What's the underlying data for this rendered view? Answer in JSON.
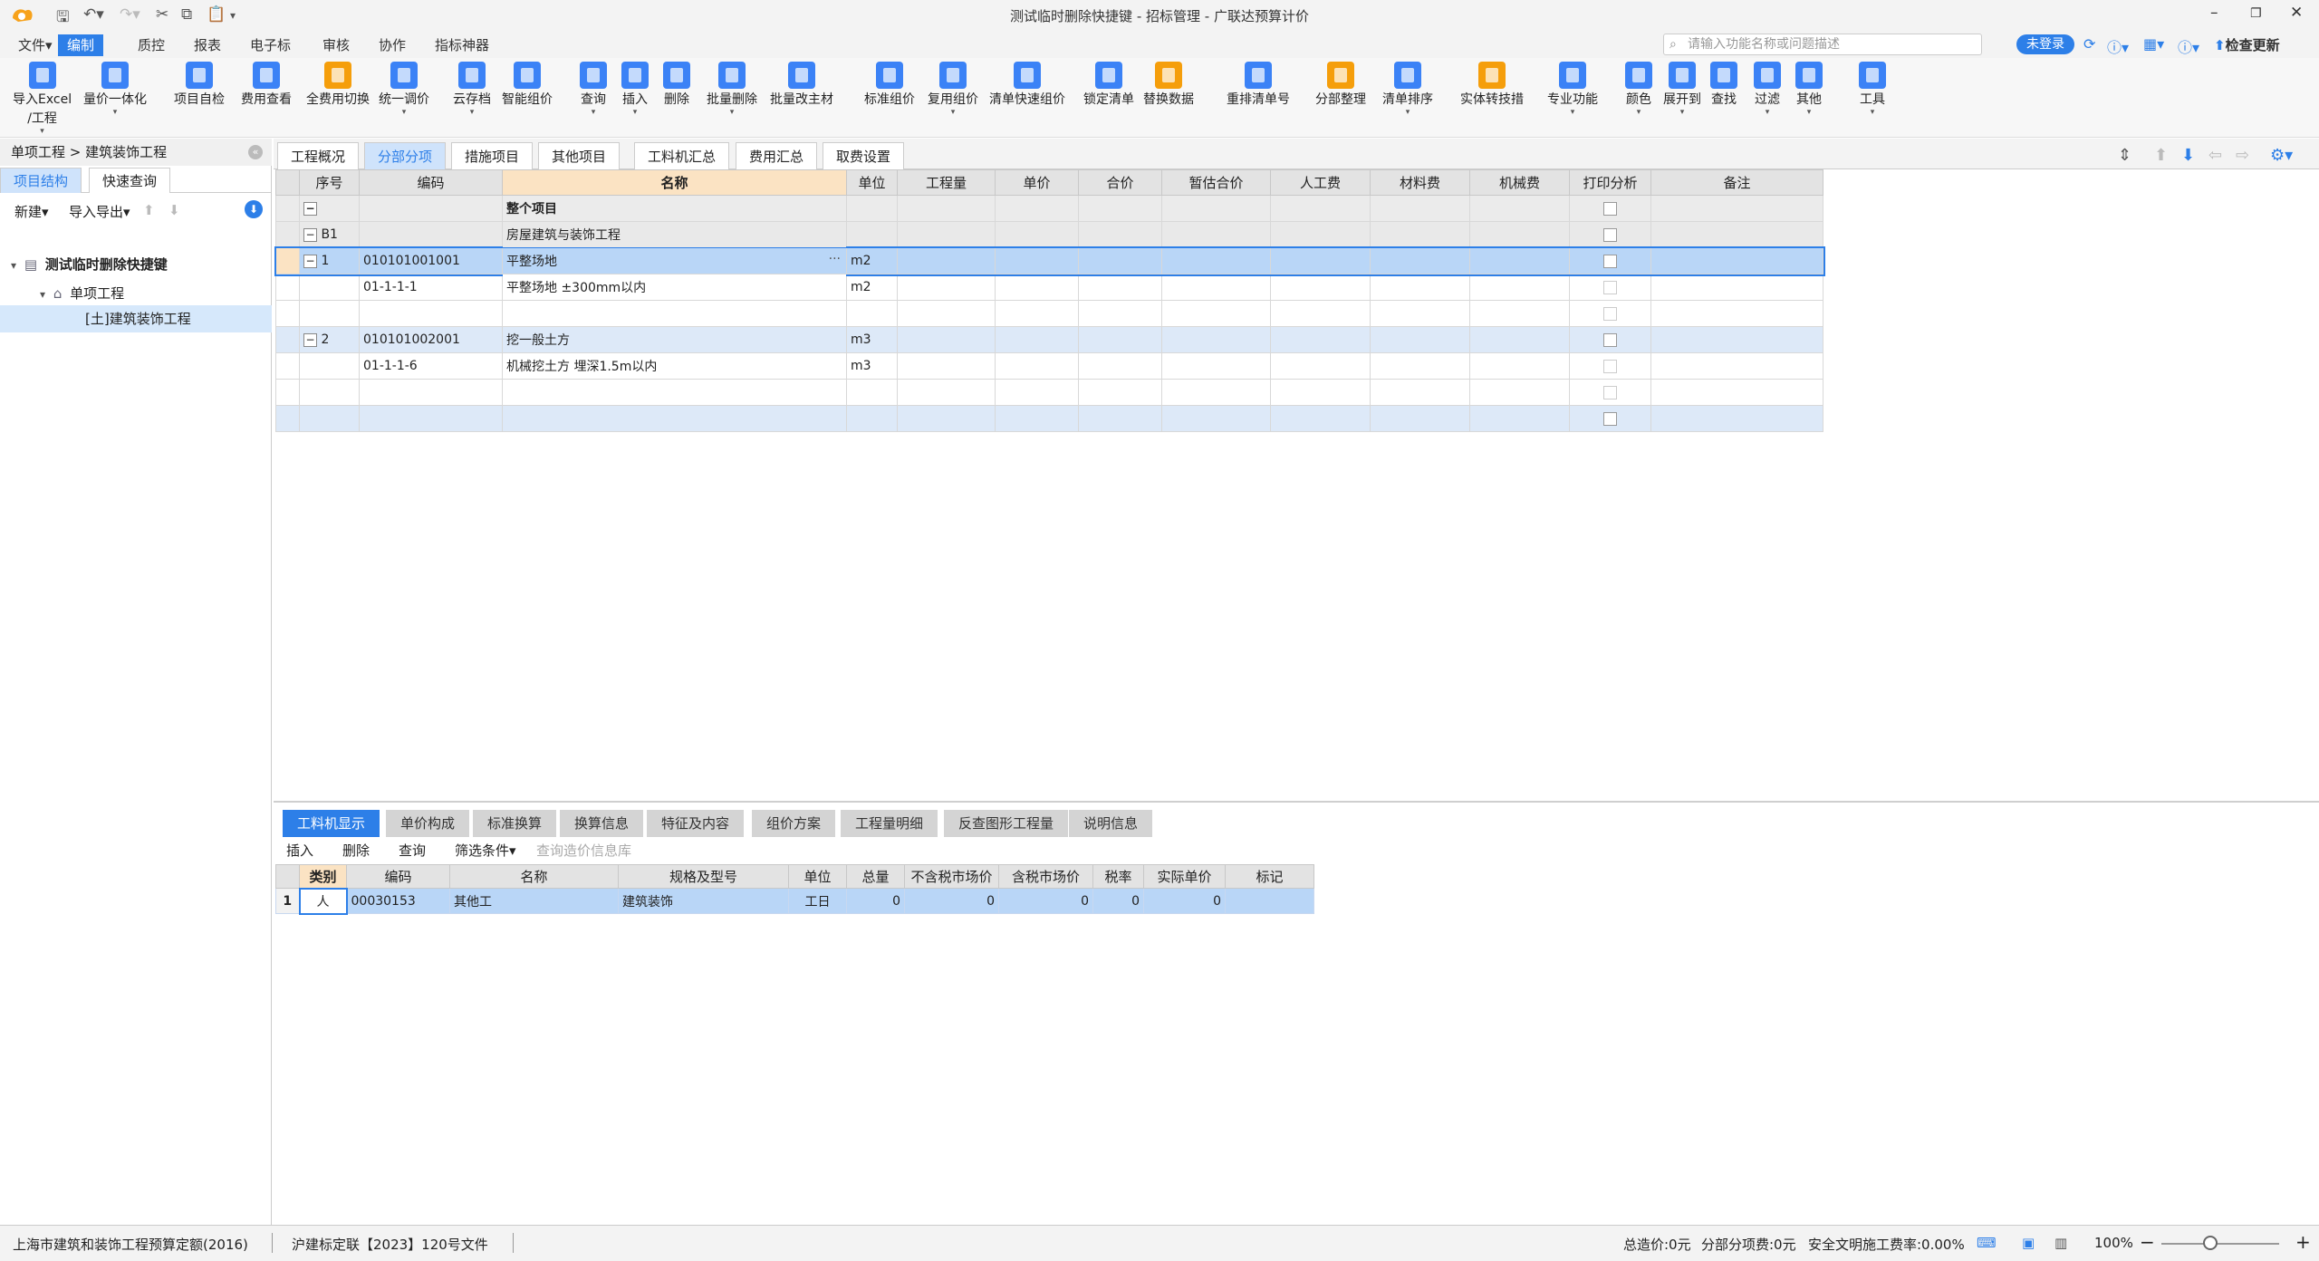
{
  "window": {
    "title": "测试临时删除快捷键 - 招标管理 - 广联达预算计价",
    "controls": {
      "minimize": "–",
      "restore": "❐",
      "close": "✕"
    }
  },
  "menu": {
    "items": [
      "文件▾",
      "编制",
      "质控",
      "报表",
      "电子标",
      "审核",
      "协作",
      "指标神器"
    ],
    "active_index": 1,
    "search_placeholder": "请输入功能名称或问题描述",
    "login_label": "未登录",
    "update_label": "检查更新"
  },
  "toolbar": {
    "buttons": [
      {
        "label": "导入Excel",
        "label2": "/工程",
        "arrow": "▾",
        "icon": "import-excel-icon",
        "color": "#3b82f6"
      },
      {
        "label": "量价一体化",
        "arrow": "▾",
        "icon": "quantity-price-icon",
        "color": "#3b82f6"
      },
      {
        "label": "项目自检",
        "icon": "self-check-icon",
        "color": "#3b82f6"
      },
      {
        "label": "费用查看",
        "icon": "fee-view-icon",
        "color": "#3b82f6"
      },
      {
        "label": "全费用切换",
        "icon": "full-fee-icon",
        "color": "#f59e0b"
      },
      {
        "label": "统一调价",
        "arrow": "▾",
        "icon": "adjust-price-icon",
        "color": "#3b82f6"
      },
      {
        "label": "云存档",
        "arrow": "▾",
        "icon": "cloud-archive-icon",
        "color": "#3b82f6"
      },
      {
        "label": "智能组价",
        "icon": "smart-pricing-icon",
        "color": "#3b82f6"
      },
      {
        "label": "查询",
        "arrow": "▾",
        "icon": "query-icon",
        "color": "#3b82f6"
      },
      {
        "label": "插入",
        "arrow": "▾",
        "icon": "insert-icon",
        "color": "#3b82f6"
      },
      {
        "label": "删除",
        "icon": "delete-icon",
        "color": "#3b82f6"
      },
      {
        "label": "批量删除",
        "arrow": "▾",
        "icon": "batch-delete-icon",
        "color": "#3b82f6"
      },
      {
        "label": "批量改主材",
        "icon": "batch-material-icon",
        "color": "#3b82f6"
      },
      {
        "label": "标准组价",
        "icon": "standard-pricing-icon",
        "color": "#3b82f6"
      },
      {
        "label": "复用组价",
        "arrow": "▾",
        "icon": "reuse-pricing-icon",
        "color": "#3b82f6"
      },
      {
        "label": "清单快速组价",
        "icon": "quick-pricing-icon",
        "color": "#3b82f6"
      },
      {
        "label": "锁定清单",
        "icon": "lock-icon",
        "color": "#3b82f6"
      },
      {
        "label": "替换数据",
        "icon": "replace-data-icon",
        "color": "#f59e0b"
      },
      {
        "label": "重排清单号",
        "icon": "renumber-icon",
        "color": "#3b82f6"
      },
      {
        "label": "分部整理",
        "icon": "section-organize-icon",
        "color": "#f59e0b"
      },
      {
        "label": "清单排序",
        "arrow": "▾",
        "icon": "sort-icon",
        "color": "#3b82f6"
      },
      {
        "label": "实体转技措",
        "icon": "convert-icon",
        "color": "#f59e0b"
      },
      {
        "label": "专业功能",
        "arrow": "▾",
        "icon": "professional-icon",
        "color": "#3b82f6"
      },
      {
        "label": "颜色",
        "arrow": "▾",
        "icon": "color-icon",
        "color": "#3b82f6"
      },
      {
        "label": "展开到",
        "arrow": "▾",
        "icon": "expand-icon",
        "color": "#3b82f6"
      },
      {
        "label": "查找",
        "icon": "find-icon",
        "color": "#3b82f6"
      },
      {
        "label": "过滤",
        "arrow": "▾",
        "icon": "filter-icon",
        "color": "#3b82f6"
      },
      {
        "label": "其他",
        "arrow": "▾",
        "icon": "other-icon",
        "color": "#3b82f6"
      },
      {
        "label": "工具",
        "arrow": "▾",
        "icon": "tools-icon",
        "color": "#3b82f6"
      }
    ]
  },
  "left_panel": {
    "breadcrumb": "单项工程 > 建筑装饰工程",
    "tabs": [
      "项目结构",
      "快速查询"
    ],
    "actions": {
      "new": "新建▾",
      "import_export": "导入导出▾"
    },
    "tree": [
      {
        "label": "测试临时删除快捷键",
        "level": 0,
        "icon": "project-icon",
        "toggle": "▾"
      },
      {
        "label": "单项工程",
        "level": 1,
        "icon": "home-icon",
        "toggle": "▾"
      },
      {
        "label": "[土]建筑装饰工程",
        "level": 2,
        "selected": true
      }
    ]
  },
  "main_tabs": [
    "工程概况",
    "分部分项",
    "措施项目",
    "其他项目",
    "工料机汇总",
    "费用汇总",
    "取费设置"
  ],
  "main_tabs_active": 1,
  "grid": {
    "columns": [
      "序号",
      "编码",
      "名称",
      "单位",
      "工程量",
      "单价",
      "合价",
      "暂估合价",
      "人工费",
      "材料费",
      "机械费",
      "打印分析",
      "备注"
    ],
    "rows": [
      {
        "type": "total",
        "expander": "−",
        "seq": "",
        "code": "",
        "name": "整个项目",
        "unit": ""
      },
      {
        "type": "div",
        "expander": "−",
        "seq": "B1",
        "code": "",
        "name": "房屋建筑与装饰工程",
        "unit": ""
      },
      {
        "type": "sel",
        "expander": "−",
        "seq": "1",
        "code": "010101001001",
        "name": "平整场地",
        "unit": "m2",
        "more": "···"
      },
      {
        "type": "quota",
        "seq": "",
        "code": "01-1-1-1",
        "name": "平整场地 ±300mm以内",
        "unit": "m2"
      },
      {
        "type": "quota",
        "seq": "",
        "code": "",
        "name": "",
        "unit": ""
      },
      {
        "type": "list",
        "expander": "−",
        "seq": "2",
        "code": "010101002001",
        "name": "挖一般土方",
        "unit": "m3"
      },
      {
        "type": "quota",
        "seq": "",
        "code": "01-1-1-6",
        "name": "机械挖土方 埋深1.5m以内",
        "unit": "m3"
      },
      {
        "type": "quota",
        "seq": "",
        "code": "",
        "name": "",
        "unit": ""
      },
      {
        "type": "list",
        "seq": "",
        "code": "",
        "name": "",
        "unit": ""
      }
    ]
  },
  "bottom_panel": {
    "tabs": [
      "工料机显示",
      "单价构成",
      "标准换算",
      "换算信息",
      "特征及内容",
      "组价方案",
      "工程量明细",
      "反查图形工程量",
      "说明信息"
    ],
    "active_index": 0,
    "actions": [
      "插入",
      "删除",
      "查询",
      "筛选条件▾",
      "查询造价信息库"
    ],
    "columns": [
      "类别",
      "编码",
      "名称",
      "规格及型号",
      "单位",
      "总量",
      "不含税市场价",
      "含税市场价",
      "税率",
      "实际单价",
      "标记"
    ],
    "rows": [
      {
        "idx": "1",
        "category": "人",
        "code": "00030153",
        "name": "其他工",
        "spec": "建筑装饰",
        "unit": "工日",
        "total": "0",
        "price_ex": "0",
        "price_in": "0",
        "tax": "0",
        "actual": "0",
        "mark": ""
      }
    ]
  },
  "status_bar": {
    "quota": "上海市建筑和装饰工程预算定额(2016)",
    "document": "沪建标定联【2023】120号文件",
    "total_cost": "总造价:0元",
    "section_cost": "分部分项费:0元",
    "safety_rate": "安全文明施工费率:0.00%",
    "zoom": "100%"
  }
}
